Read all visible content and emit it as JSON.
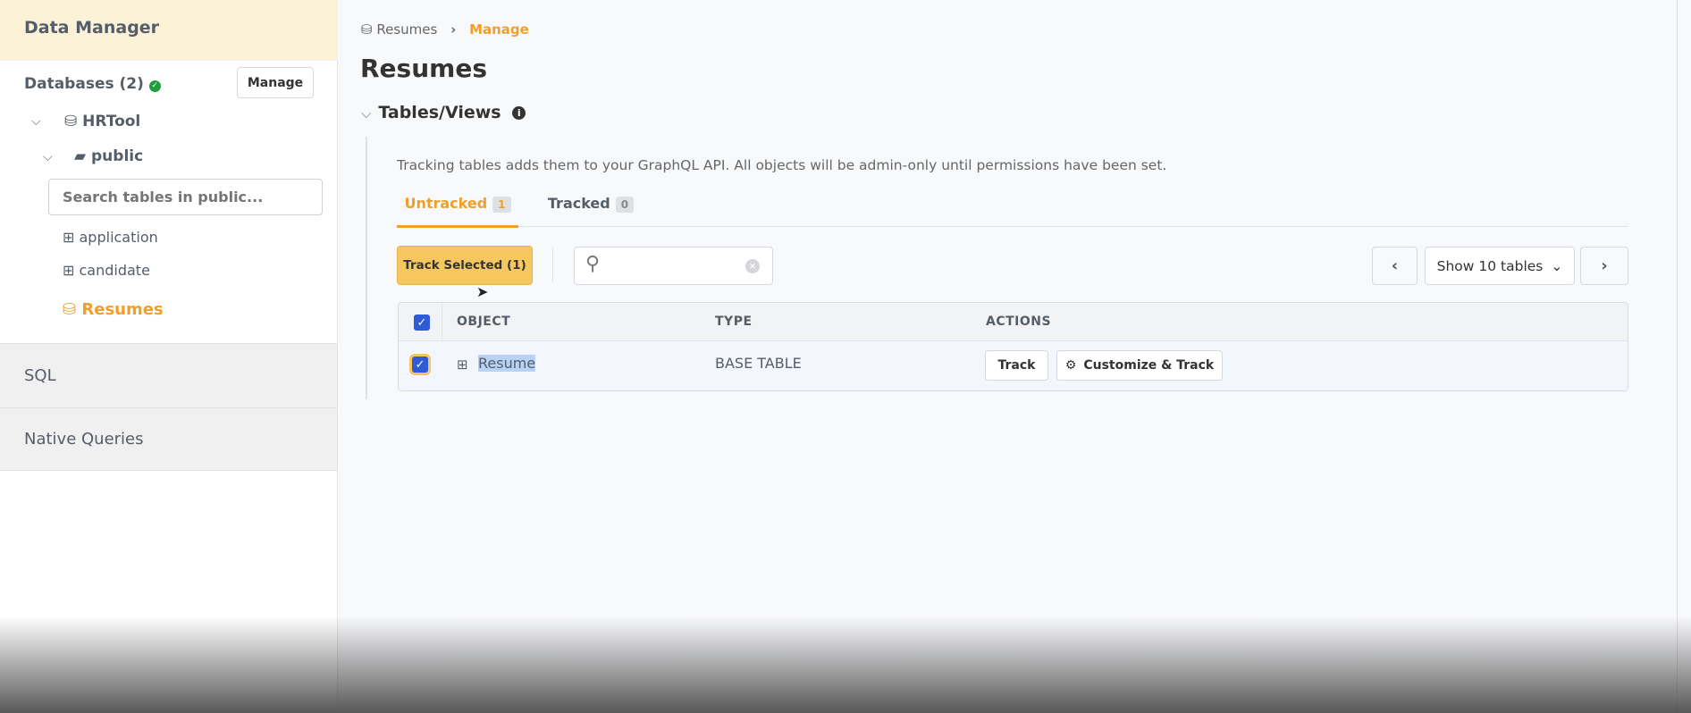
{
  "sidebar": {
    "title": "Data Manager",
    "databases_label": "Databases (2)",
    "manage_label": "Manage",
    "db_name": "HRTool",
    "schema": "public",
    "search_placeholder": "Search tables in public...",
    "tables": [
      "application",
      "candidate"
    ],
    "active_item": "Resumes",
    "sections": [
      "SQL",
      "Native Queries"
    ]
  },
  "breadcrumb": {
    "items": [
      "Resumes",
      "Manage"
    ]
  },
  "page_title": "Resumes",
  "section_title": "Tables/Views",
  "description": "Tracking tables adds them to your GraphQL API. All objects will be admin-only until permissions have been set.",
  "tabs": [
    {
      "label": "Untracked",
      "count": "1"
    },
    {
      "label": "Tracked",
      "count": "0"
    }
  ],
  "toolbar": {
    "track_selected": "Track Selected (1)",
    "search_value": "",
    "page_size": "Show 10 tables"
  },
  "table": {
    "columns": [
      "OBJECT",
      "TYPE",
      "ACTIONS"
    ],
    "rows": [
      {
        "object": "Resume",
        "type": "BASE TABLE",
        "actions": [
          "Track",
          "Customize & Track"
        ],
        "checked": true
      }
    ]
  },
  "colors": {
    "accent": "#f0a029",
    "checkbox": "#2f5bd7",
    "header_bg": "#fbf2d8"
  }
}
